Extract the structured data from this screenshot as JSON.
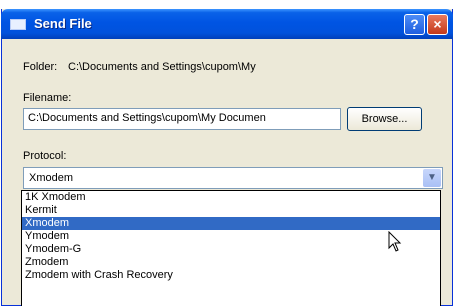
{
  "window": {
    "title": "Send File",
    "help_label": "?",
    "close_label": "×"
  },
  "folder": {
    "label": "Folder:",
    "value": "C:\\Documents and Settings\\cupom\\My"
  },
  "filename": {
    "label": "Filename:",
    "value": "C:\\Documents and Settings\\cupom\\My Documen"
  },
  "browse_label": "Browse...",
  "protocol": {
    "label": "Protocol:",
    "selected": "Xmodem",
    "options": [
      "1K Xmodem",
      "Kermit",
      "Xmodem",
      "Ymodem",
      "Ymodem-G",
      "Zmodem",
      "Zmodem with Crash Recovery"
    ]
  }
}
